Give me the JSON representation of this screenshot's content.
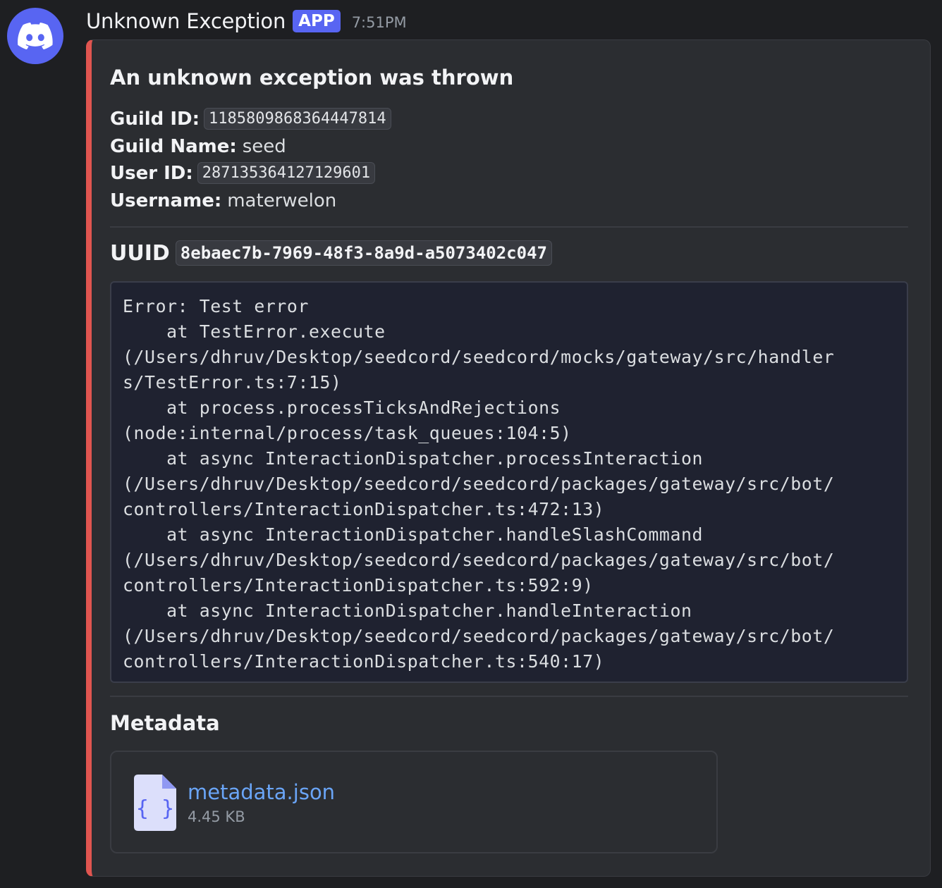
{
  "message": {
    "author": "Unknown Exception",
    "badge": "APP",
    "timestamp": "7:51PM"
  },
  "colors": {
    "embed_accent": "#e05550",
    "brand": "#5865f2",
    "link": "#6aa5f7"
  },
  "embed": {
    "title": "An unknown exception was thrown",
    "fields": [
      {
        "label": "Guild ID:",
        "value": "1185809868364447814",
        "code": true
      },
      {
        "label": "Guild Name:",
        "value": "seed",
        "code": false
      },
      {
        "label": "User ID:",
        "value": "287135364127129601",
        "code": true
      },
      {
        "label": "Username:",
        "value": "materwelon",
        "code": false
      }
    ],
    "uuid_label": "UUID",
    "uuid_value": "8ebaec7b-7969-48f3-8a9d-a5073402c047",
    "stack_lines": [
      "Error: Test error",
      "    at TestError.execute",
      "(/Users/dhruv/Desktop/seedcord/seedcord/mocks/gateway/src/handler",
      "s/TestError.ts:7:15)",
      "    at process.processTicksAndRejections",
      "(node:internal/process/task_queues:104:5)",
      "    at async InteractionDispatcher.processInteraction",
      "(/Users/dhruv/Desktop/seedcord/seedcord/packages/gateway/src/bot/",
      "controllers/InteractionDispatcher.ts:472:13)",
      "    at async InteractionDispatcher.handleSlashCommand",
      "(/Users/dhruv/Desktop/seedcord/seedcord/packages/gateway/src/bot/",
      "controllers/InteractionDispatcher.ts:592:9)",
      "    at async InteractionDispatcher.handleInteraction",
      "(/Users/dhruv/Desktop/seedcord/seedcord/packages/gateway/src/bot/",
      "controllers/InteractionDispatcher.ts:540:17)"
    ],
    "metadata_heading": "Metadata",
    "attachment": {
      "icon": "json-file-icon",
      "icon_glyph": "{ }",
      "name": "metadata.json",
      "size": "4.45 KB"
    }
  }
}
